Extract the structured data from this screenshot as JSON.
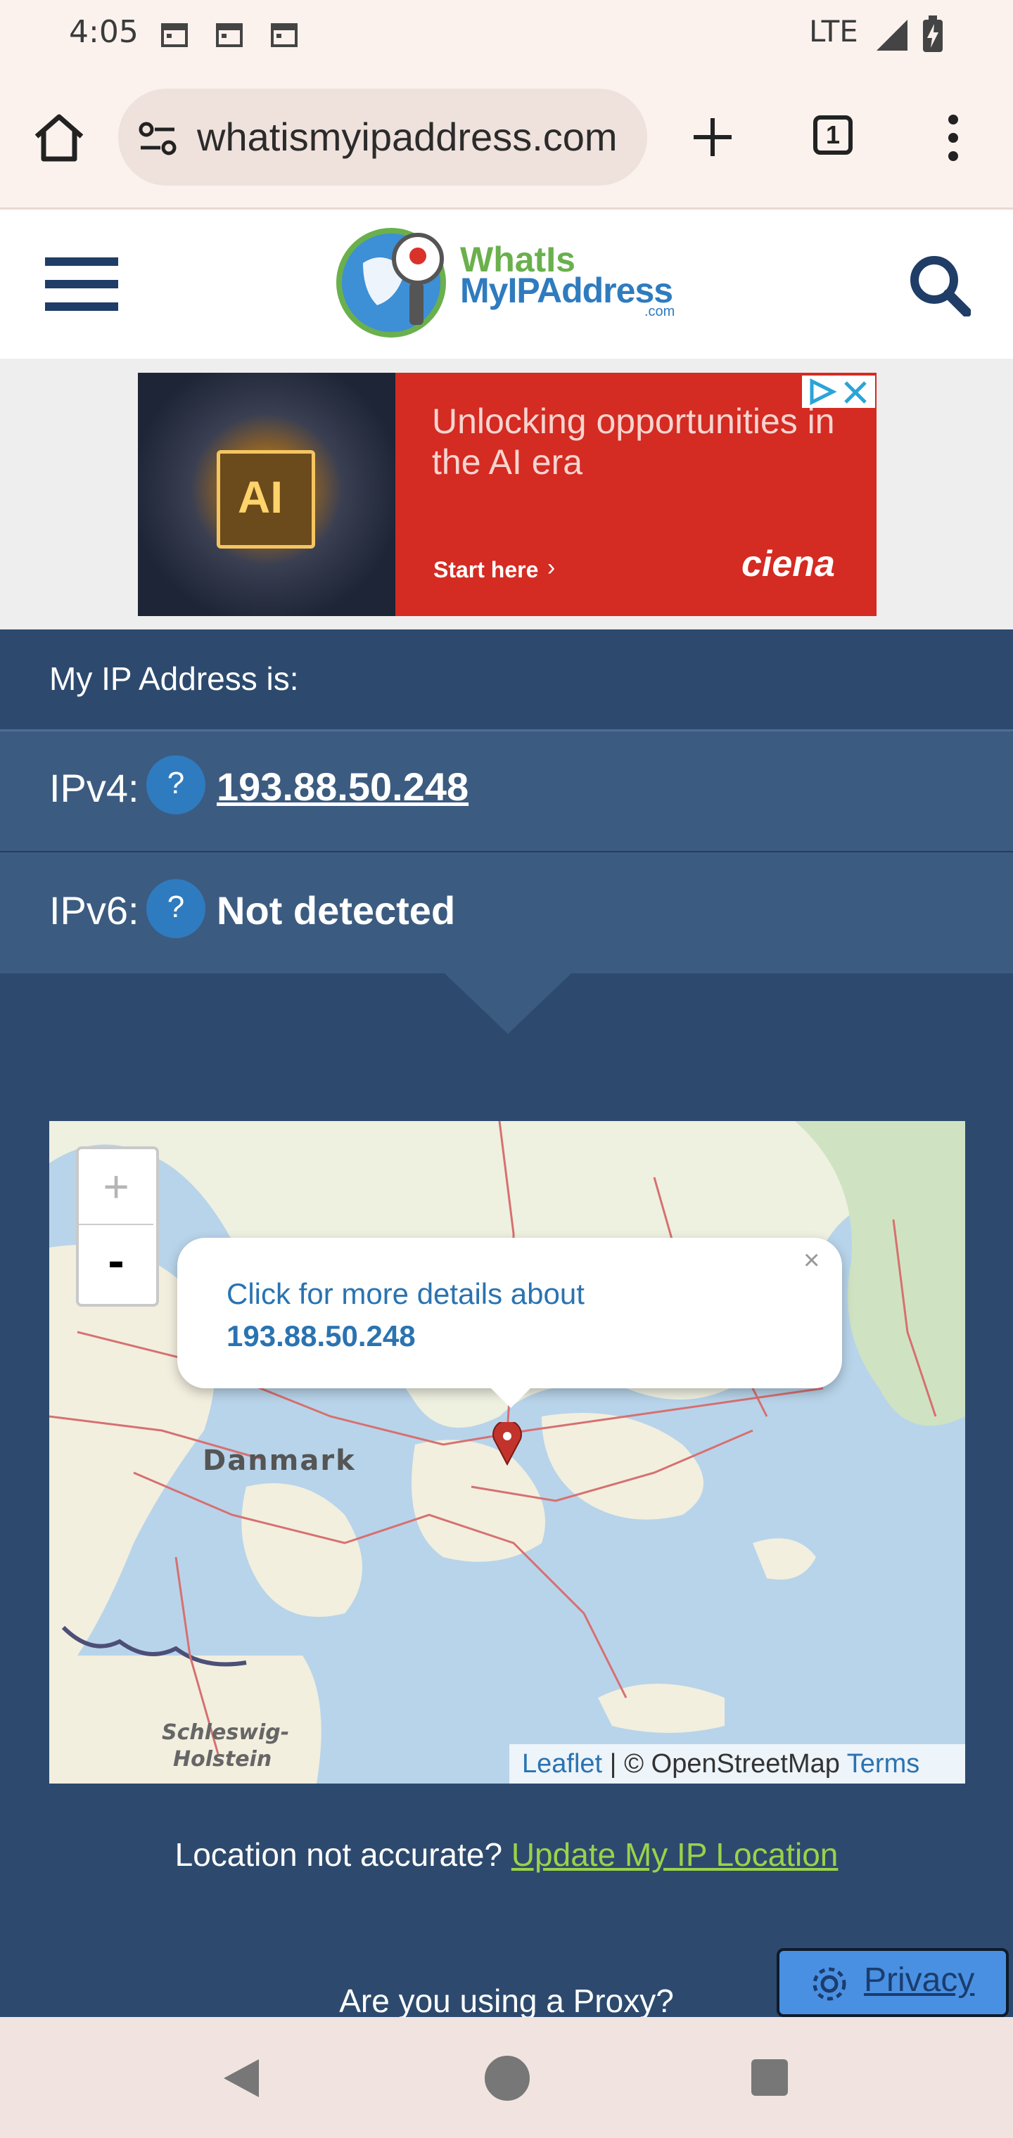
{
  "status_bar": {
    "time": "4:05",
    "network": "LTE"
  },
  "browser": {
    "url": "whatismyipaddress.com",
    "tab_count": "1"
  },
  "site": {
    "logo_line1": "WhatIs",
    "logo_line2": "MyIPAddress",
    "logo_suffix": ".com"
  },
  "ad": {
    "headline": "Unlocking opportunities in the AI era",
    "chip_text": "AI",
    "cta": "Start here",
    "brand": "ciena"
  },
  "ip_panel": {
    "heading": "My IP Address is:",
    "ipv4_label": "IPv4:",
    "ipv4_value": "193.88.50.248",
    "ipv6_label": "IPv6:",
    "ipv6_value": "Not detected",
    "help_glyph": "?"
  },
  "map": {
    "popup_line1": "Click for more details about",
    "popup_ip": "193.88.50.248",
    "popup_close": "×",
    "zoom_in": "+",
    "zoom_out": "-",
    "label_country": "Danmark",
    "label_region": "Schleswig-Holstein",
    "label_region_line1": "Schleswig-",
    "label_region_line2": "Holstein",
    "attribution_leaflet": "Leaflet",
    "attribution_sep": " | © OpenStreetMap ",
    "attribution_terms": "Terms"
  },
  "location": {
    "question": "Location not accurate? ",
    "link": "Update My IP Location"
  },
  "proxy_question": "Are you using a Proxy?",
  "privacy_button": "Privacy",
  "colors": {
    "panel": "#2d4a6e",
    "row": "#3c5b80",
    "accent_link": "#9ad34a",
    "ad_red": "#d42b22"
  }
}
